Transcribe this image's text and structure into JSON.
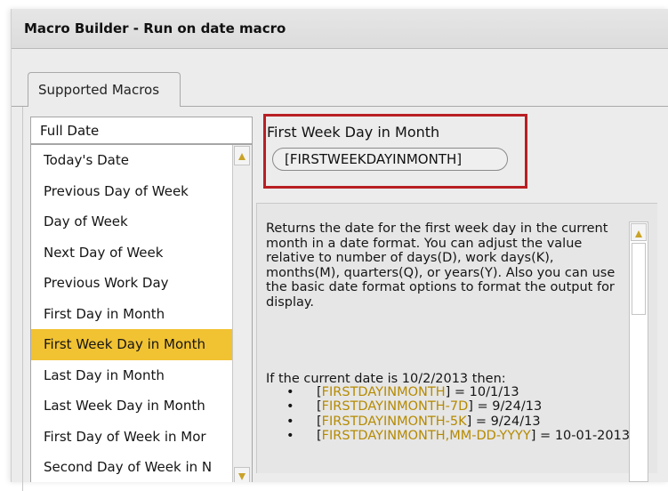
{
  "window": {
    "title": "Macro Builder - Run on date macro"
  },
  "tabs": [
    {
      "label": "Supported Macros"
    }
  ],
  "category_select": {
    "value": "Full Date"
  },
  "macro_list": {
    "items": [
      "Today's Date",
      "Previous Day of Week",
      "Day of Week",
      "Next Day of Week",
      "Previous Work Day",
      "First Day in Month",
      "First Week Day in Month",
      "Last Day in Month",
      "Last Week Day in Month",
      "First Day of Week in Mor",
      "Second Day of Week in N"
    ],
    "selected_index": 6
  },
  "macro_detail": {
    "title": "First Week Day in Month",
    "code": "[FIRSTWEEKDAYINMONTH]",
    "description": "Returns the date for the first week day in the current month in a date format. You can adjust the value relative to number of days(D), work days(K), months(M), quarters(Q), or years(Y). Also you can use the basic date format options to format the output for display.",
    "condition": "If the current date is 10/2/2013 then:",
    "examples": [
      {
        "open": "[",
        "macro": "FIRSTDAYINMONTH",
        "close": "]",
        "result": " = 10/1/13"
      },
      {
        "open": "[",
        "macro": "FIRSTDAYINMONTH-7D",
        "close": "]",
        "result": " = 9/24/13"
      },
      {
        "open": "[",
        "macro": "FIRSTDAYINMONTH-5K",
        "close": "]",
        "result": " = 9/24/13"
      },
      {
        "open": "[",
        "macro": "FIRSTDAYINMONTH,MM-DD-YYYY",
        "close": "]",
        "result": " = 10-01-2013"
      }
    ]
  },
  "colors": {
    "selection": "#f1c232",
    "highlight_border": "#b81f24",
    "macro_text": "#b58a00"
  },
  "icons": {
    "scroll_up": "triangle-up",
    "scroll_down": "triangle-down",
    "bullet": "•"
  }
}
